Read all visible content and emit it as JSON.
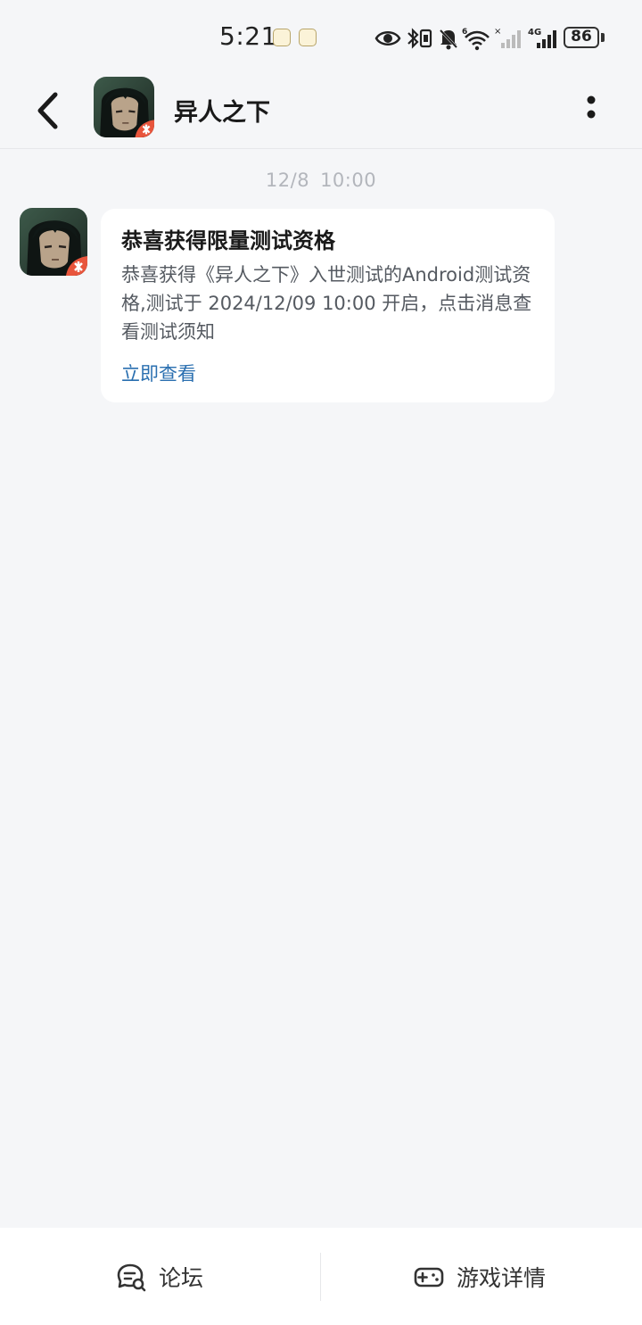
{
  "status_bar": {
    "time": "5:21",
    "battery": "86",
    "icons": [
      "notification-icon",
      "notification-icon",
      "eye-icon",
      "bluetooth-icon",
      "vibrate-icon",
      "mute-icon",
      "wifi-icon",
      "signal-icon",
      "signal-4g-icon",
      "battery-icon"
    ]
  },
  "header": {
    "title": "异人之下",
    "back_icon": "chevron-left-icon",
    "more_icon": "more-vertical-icon"
  },
  "conversation": {
    "timestamp_date": "12/8",
    "timestamp_time": "10:00",
    "message": {
      "title": "恭喜获得限量测试资格",
      "body": "恭喜获得《异人之下》入世测试的Android测试资格,测试于 2024/12/09 10:00 开启，点击消息查看测试须知",
      "link": "立即查看"
    }
  },
  "bottom_bar": {
    "forum_label": "论坛",
    "game_details_label": "游戏详情"
  },
  "colors": {
    "background": "#f5f6f8",
    "card": "#ffffff",
    "link": "#2a6fb0",
    "timestamp": "#b3b6bc"
  }
}
